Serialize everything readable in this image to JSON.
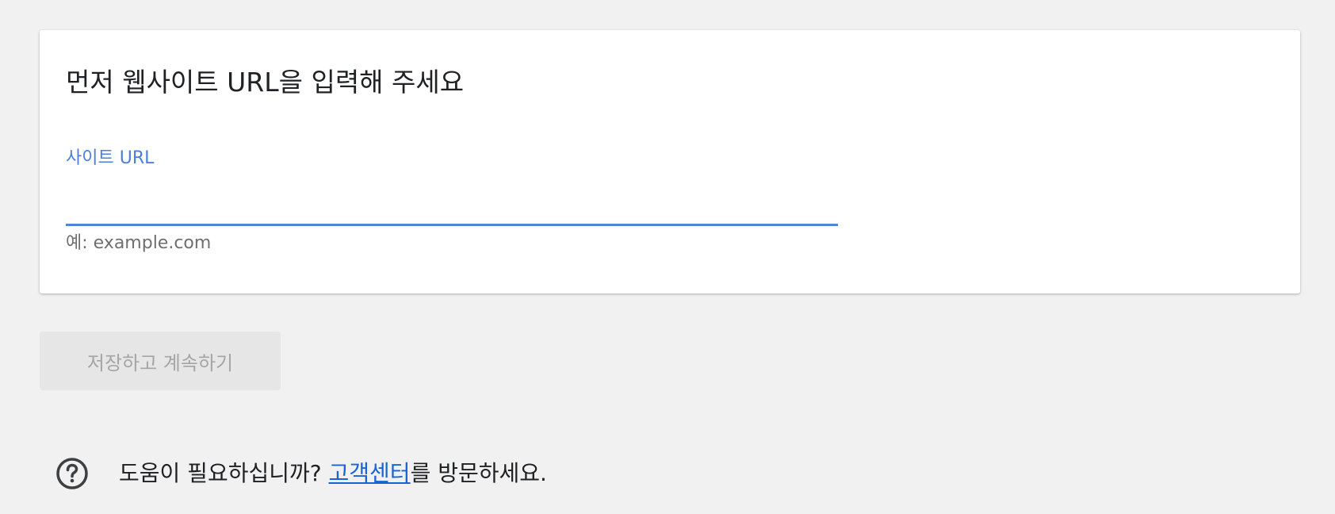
{
  "card": {
    "title": "먼저 웹사이트 URL을 입력해 주세요",
    "field_label": "사이트 URL",
    "input_value": "",
    "helper_text": "예: example.com"
  },
  "actions": {
    "save_label": "저장하고 계속하기"
  },
  "help": {
    "icon": "question-circle-icon",
    "prefix": "도움이 필요하십니까? ",
    "link_text": "고객센터",
    "suffix": "를 방문하세요."
  },
  "colors": {
    "accent": "#4f82e2",
    "link": "#1a63d6",
    "disabled_bg": "#e6e6e6",
    "disabled_text": "#a5a5a5"
  }
}
